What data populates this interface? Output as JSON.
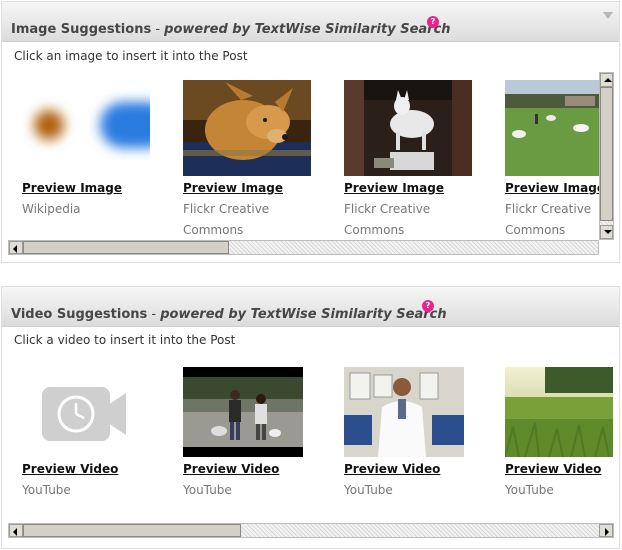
{
  "image_panel": {
    "title": "Image Suggestions",
    "separator": " - ",
    "powered_by": "powered by TextWise Similarity Search",
    "help_icon": "?",
    "instruction": "Click an image to insert it into the Post",
    "items": [
      {
        "link": "Preview Image",
        "source": "Wikipedia",
        "thumb": "blurred-dots-image"
      },
      {
        "link": "Preview Image",
        "source": "Flickr Creative Commons",
        "thumb": "dog-photo"
      },
      {
        "link": "Preview Image",
        "source": "Flickr Creative Commons",
        "thumb": "dog-statue-photo"
      },
      {
        "link": "Preview Image",
        "source": "Flickr Creative Commons",
        "thumb": "dogs-on-lawn-photo"
      }
    ]
  },
  "video_panel": {
    "title": "Video Suggestions",
    "separator": " - ",
    "powered_by": "powered by TextWise Similarity Search",
    "help_icon": "?",
    "instruction": "Click a video to insert it into the Post",
    "items": [
      {
        "link": "Preview Video",
        "source": "YouTube",
        "thumb": "video-camera-placeholder-icon"
      },
      {
        "link": "Preview Video",
        "source": "YouTube",
        "thumb": "people-walking-dog-video"
      },
      {
        "link": "Preview Video",
        "source": "YouTube",
        "thumb": "doctor-video"
      },
      {
        "link": "Preview Video",
        "source": "YouTube",
        "thumb": "grass-field-video"
      }
    ]
  },
  "colors": {
    "help_badge": "#e8248f",
    "header_text": "#464646",
    "source_text": "#777777"
  }
}
